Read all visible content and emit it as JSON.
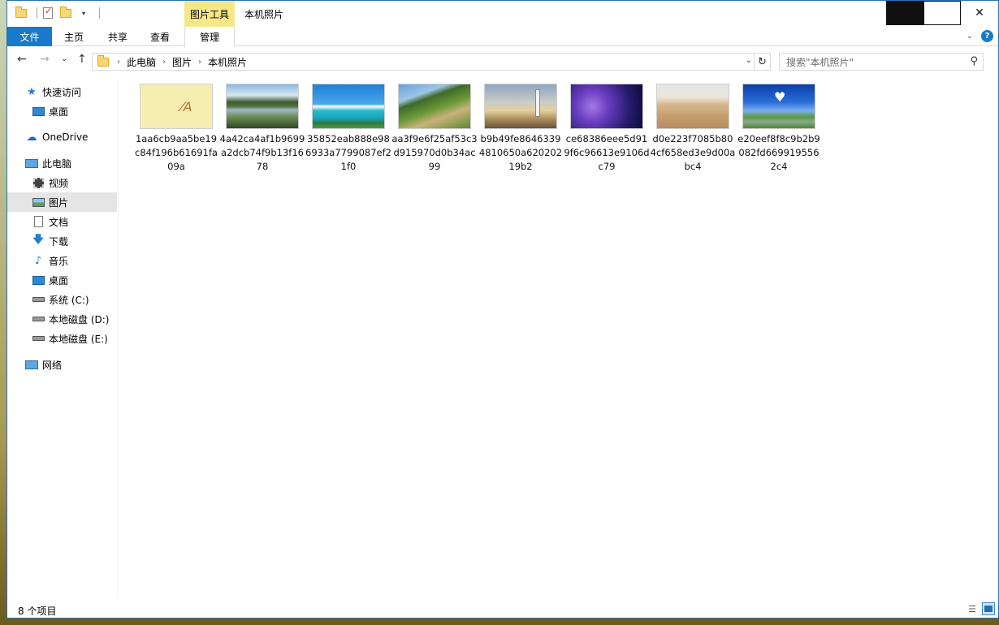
{
  "window": {
    "title": "本机照片",
    "tools_tab": "图片工具",
    "controls": {
      "minimize": "minimize",
      "maximize": "maximize",
      "close": "✕"
    }
  },
  "ribbon": {
    "tabs": [
      "文件",
      "主页",
      "共享",
      "查看",
      "管理"
    ],
    "help": "?"
  },
  "address": {
    "crumbs": [
      "此电脑",
      "图片",
      "本机照片"
    ],
    "refresh": "↻",
    "dropdown": "⌄"
  },
  "search": {
    "placeholder": "搜索\"本机照片\"",
    "icon": "⚲"
  },
  "nav_buttons": {
    "back": "←",
    "forward": "→",
    "recent": "⌄",
    "up": "↑"
  },
  "sidebar": {
    "items": [
      {
        "label": "快速访问",
        "icon": "star-icon"
      },
      {
        "label": "桌面",
        "icon": "desktop-icon"
      },
      {
        "label": "OneDrive",
        "icon": "cloud-icon"
      },
      {
        "label": "此电脑",
        "icon": "computer-icon"
      },
      {
        "label": "视频",
        "icon": "video-icon"
      },
      {
        "label": "图片",
        "icon": "pictures-icon",
        "selected": true
      },
      {
        "label": "文档",
        "icon": "document-icon"
      },
      {
        "label": "下载",
        "icon": "download-icon"
      },
      {
        "label": "音乐",
        "icon": "music-icon"
      },
      {
        "label": "桌面",
        "icon": "desktop-icon"
      },
      {
        "label": "系统 (C:)",
        "icon": "system-drive-icon"
      },
      {
        "label": "本地磁盘 (D:)",
        "icon": "drive-icon"
      },
      {
        "label": "本地磁盘 (E:)",
        "icon": "drive-icon"
      },
      {
        "label": "网络",
        "icon": "network-icon"
      }
    ]
  },
  "files": [
    {
      "name": "1aa6cb9aa5be19c84f196b61691fa09a",
      "thumb": "yellow-note"
    },
    {
      "name": "4a42ca4af1b9699a2dcb74f9b13f1678",
      "thumb": "lake-reflection"
    },
    {
      "name": "35852eab888e986933a7799087ef21f0",
      "thumb": "tropical-beach"
    },
    {
      "name": "aa3f9e6f25af53c3d915970d0b34ac99",
      "thumb": "green-path"
    },
    {
      "name": "b9b49fe86463394810650a62020219b2",
      "thumb": "lighthouse"
    },
    {
      "name": "ce68386eee5d919f6c96613e9106dc79",
      "thumb": "purple-tree-night"
    },
    {
      "name": "d0e223f7085b804cf658ed3e9d00abc4",
      "thumb": "wheat-field"
    },
    {
      "name": "e20eef8f8c9b2b9082fd6699195562c4",
      "thumb": "heart-cloud-road"
    }
  ],
  "status": {
    "count": "8 个项目"
  }
}
